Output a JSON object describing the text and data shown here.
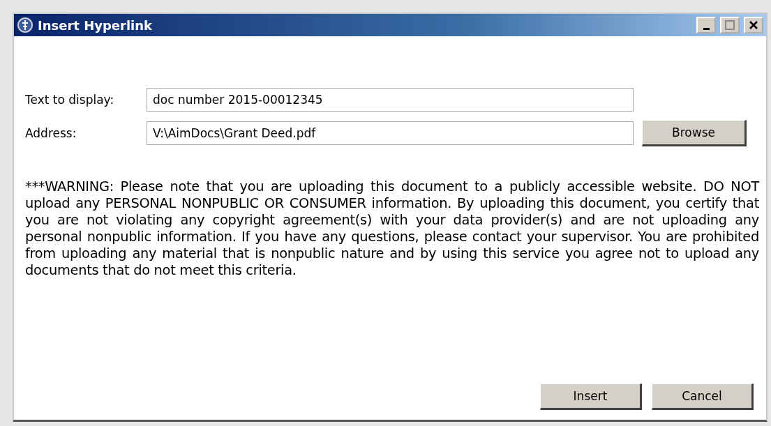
{
  "window": {
    "title": "Insert Hyperlink"
  },
  "fields": [
    {
      "label": "Text to display:",
      "value": "doc number 2015-00012345"
    },
    {
      "label": "Address:",
      "value": "V:\\AimDocs\\Grant Deed.pdf",
      "button": "Browse"
    }
  ],
  "warning": "***WARNING: Please note that you are uploading this document to a publicly accessible website. DO NOT upload any PERSONAL NONPUBLIC OR CONSUMER information. By uploading this document, you certify that you are not violating any copyright agreement(s) with your data provider(s) and are not uploading any personal nonpublic information.  If you have any questions, please contact your supervisor.  You are prohibited from uploading any material that is nonpublic nature and by using this service you agree not to upload any documents that do not meet this criteria.",
  "buttons": [
    "Insert",
    "Cancel"
  ]
}
